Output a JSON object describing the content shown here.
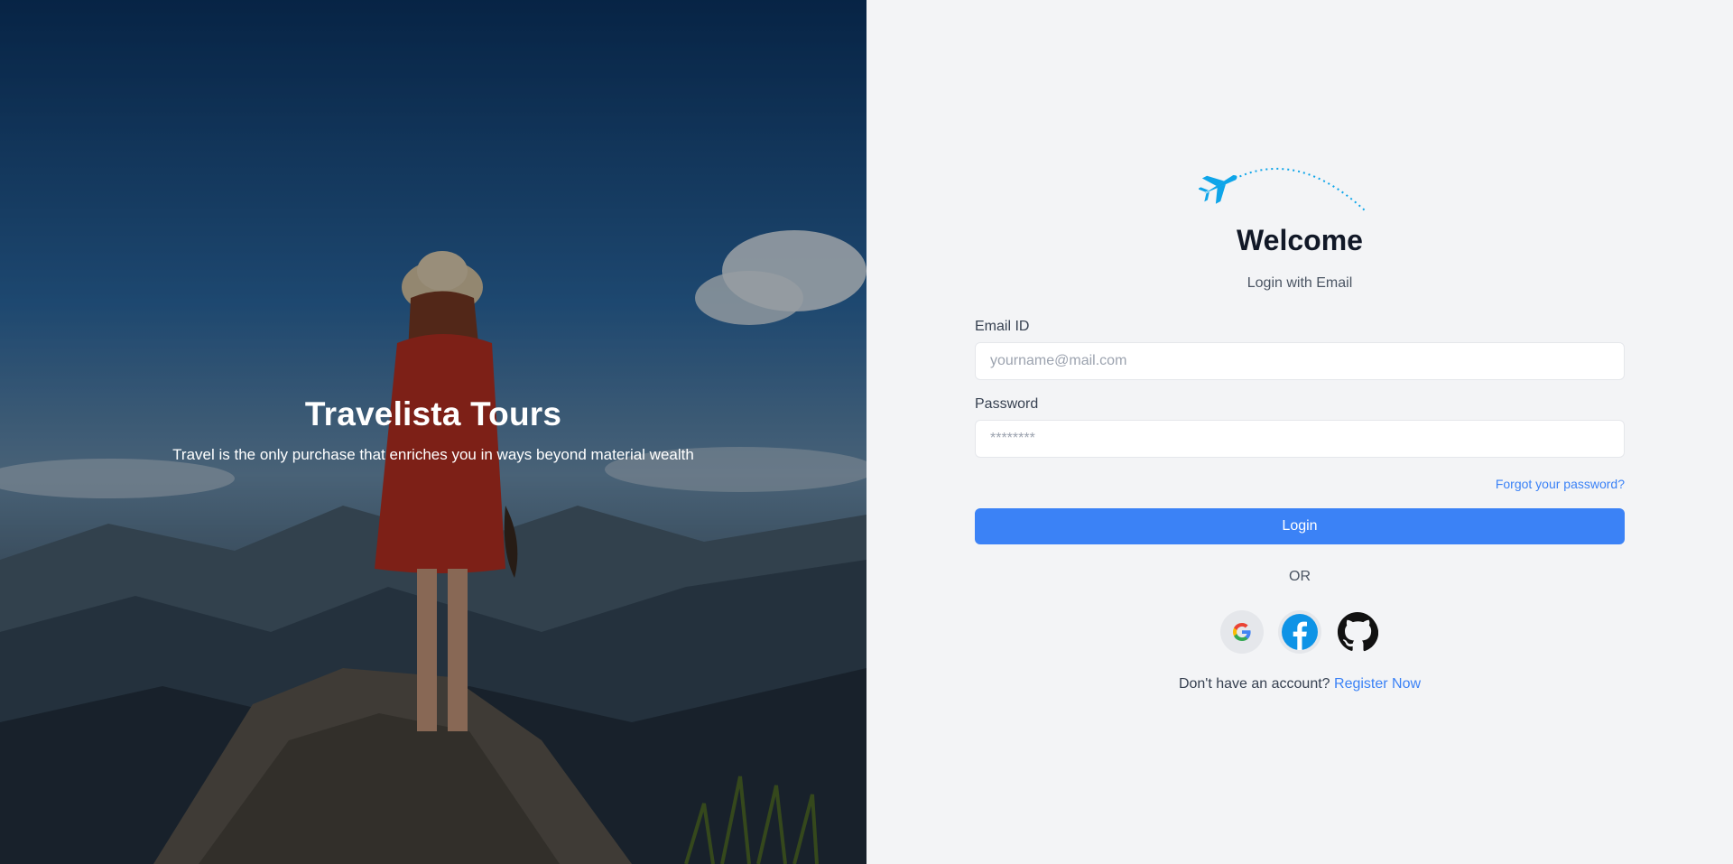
{
  "hero": {
    "title": "Travelista Tours",
    "subtitle": "Travel is the only purchase that enriches you in ways beyond material wealth",
    "background_image": "woman-on-mountain-photo"
  },
  "login": {
    "icon": "airplane-icon",
    "title": "Welcome",
    "subtitle": "Login with Email",
    "email": {
      "label": "Email ID",
      "placeholder": "yourname@mail.com",
      "value": ""
    },
    "password": {
      "label": "Password",
      "placeholder": "********",
      "value": ""
    },
    "forgot_label": "Forgot your password?",
    "login_label": "Login",
    "divider_label": "OR",
    "social": [
      {
        "name": "google",
        "icon": "google-icon"
      },
      {
        "name": "facebook",
        "icon": "facebook-icon"
      },
      {
        "name": "github",
        "icon": "github-icon"
      }
    ],
    "register_prompt": "Don't have an account?",
    "register_label": "Register Now"
  },
  "colors": {
    "accent": "#3b82f6",
    "plane": "#0ea5e9",
    "panel_bg": "#f3f4f6",
    "title_text": "#111827"
  }
}
